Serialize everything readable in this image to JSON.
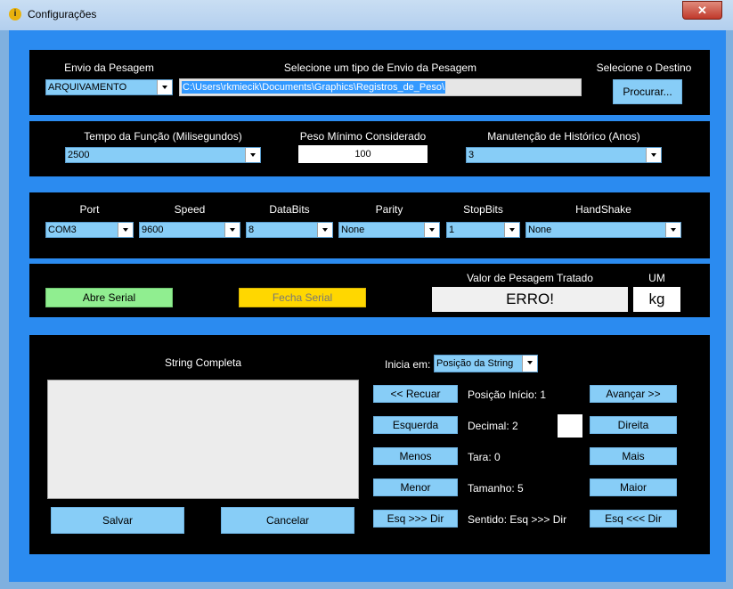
{
  "window": {
    "title": "Configurações",
    "close_glyph": "✕"
  },
  "envio": {
    "label": "Envio da Pesagem",
    "value": "ARQUIVAMENTO",
    "tipo_label": "Selecione um tipo de Envio da Pesagem",
    "path": "C:\\Users\\rkmiecik\\Documents\\Graphics\\Registros_de_Peso\\",
    "destino_label": "Selecione o Destino",
    "procurar": "Procurar..."
  },
  "funcao": {
    "tempo_label": "Tempo da Função (Milisegundos)",
    "tempo_value": "2500",
    "peso_label": "Peso Mínimo Considerado",
    "peso_value": "100",
    "historico_label": "Manutenção de Histórico (Anos)",
    "historico_value": "3"
  },
  "serial": {
    "port_label": "Port",
    "port_value": "COM3",
    "speed_label": "Speed",
    "speed_value": "9600",
    "databits_label": "DataBits",
    "databits_value": "8",
    "parity_label": "Parity",
    "parity_value": "None",
    "stopbits_label": "StopBits",
    "stopbits_value": "1",
    "handshake_label": "HandShake",
    "handshake_value": "None"
  },
  "status": {
    "abre": "Abre Serial",
    "fecha": "Fecha Serial",
    "valor_label": "Valor de Pesagem Tratado",
    "valor": "ERRO!",
    "um_label": "UM",
    "um": "kg",
    "colors": {
      "abre": "#90ee90",
      "fecha": "#ffd700"
    }
  },
  "string": {
    "label": "String Completa",
    "inicia_label": "Inicia em:",
    "inicia_value": "Posição da String",
    "recuar": "<< Recuar",
    "avancar": "Avançar >>",
    "posicao": "Posição Início: 1",
    "esquerda": "Esquerda",
    "direita": "Direita",
    "decimal": "Decimal: 2",
    "menos": "Menos",
    "mais": "Mais",
    "tara": "Tara: 0",
    "menor": "Menor",
    "maior": "Maior",
    "tamanho": "Tamanho: 5",
    "esq_dir": "Esq >>> Dir",
    "dir_esq": "Esq <<< Dir",
    "sentido": "Sentido: Esq >>> Dir",
    "salvar": "Salvar",
    "cancelar": "Cancelar"
  }
}
